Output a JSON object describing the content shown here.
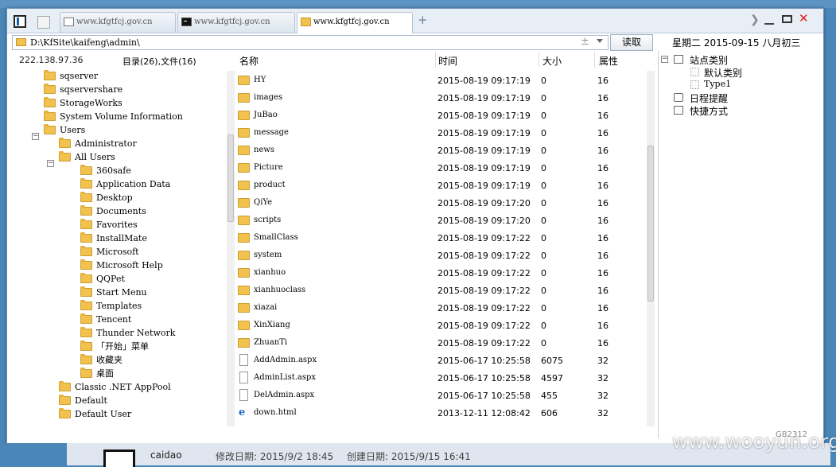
{
  "tabs": [
    {
      "label": "www.kfgtfcj.gov.cn",
      "icon": "page-icon"
    },
    {
      "label": "www.kfgtfcj.gov.cn",
      "icon": "terminal-icon"
    },
    {
      "label": "www.kfgtfcj.gov.cn",
      "icon": "folder-icon"
    }
  ],
  "new_tab": "+",
  "address": {
    "value": "D:\\KfSite\\kaifeng\\admin\\",
    "spin": "±",
    "read_button": "读取"
  },
  "date_label": "星期二 2015-09-15 八月初三",
  "info": {
    "ip": "222.138.97.36",
    "dir_count": "目录(26),文件(16)"
  },
  "columns": {
    "name": "名称",
    "time": "时间",
    "size": "大小",
    "attr": "属性"
  },
  "tree": [
    {
      "label": "sqserver"
    },
    {
      "label": "sqservershare"
    },
    {
      "label": "StorageWorks"
    },
    {
      "label": "System Volume Information"
    },
    {
      "label": "Users",
      "toggle": "⊟"
    },
    {
      "label": "Administrator"
    },
    {
      "label": "All Users",
      "toggle": "⊟"
    },
    {
      "label": "360safe"
    },
    {
      "label": "Application Data"
    },
    {
      "label": "Desktop"
    },
    {
      "label": "Documents"
    },
    {
      "label": "Favorites"
    },
    {
      "label": "InstallMate"
    },
    {
      "label": "Microsoft"
    },
    {
      "label": "Microsoft Help"
    },
    {
      "label": "QQPet"
    },
    {
      "label": "Start Menu"
    },
    {
      "label": "Templates"
    },
    {
      "label": "Tencent"
    },
    {
      "label": "Thunder Network"
    },
    {
      "label": "「开始」菜单"
    },
    {
      "label": "收藏夹"
    },
    {
      "label": "桌面"
    },
    {
      "label": "Classic .NET AppPool"
    },
    {
      "label": "Default"
    },
    {
      "label": "Default User"
    }
  ],
  "files": [
    {
      "name": "HY",
      "time": "2015-08-19 09:17:19",
      "size": "0",
      "attr": "16",
      "type": "folder"
    },
    {
      "name": "images",
      "time": "2015-08-19 09:17:19",
      "size": "0",
      "attr": "16",
      "type": "folder"
    },
    {
      "name": "JuBao",
      "time": "2015-08-19 09:17:19",
      "size": "0",
      "attr": "16",
      "type": "folder"
    },
    {
      "name": "message",
      "time": "2015-08-19 09:17:19",
      "size": "0",
      "attr": "16",
      "type": "folder"
    },
    {
      "name": "news",
      "time": "2015-08-19 09:17:19",
      "size": "0",
      "attr": "16",
      "type": "folder"
    },
    {
      "name": "Picture",
      "time": "2015-08-19 09:17:19",
      "size": "0",
      "attr": "16",
      "type": "folder"
    },
    {
      "name": "product",
      "time": "2015-08-19 09:17:19",
      "size": "0",
      "attr": "16",
      "type": "folder"
    },
    {
      "name": "QiYe",
      "time": "2015-08-19 09:17:20",
      "size": "0",
      "attr": "16",
      "type": "folder"
    },
    {
      "name": "scripts",
      "time": "2015-08-19 09:17:20",
      "size": "0",
      "attr": "16",
      "type": "folder"
    },
    {
      "name": "SmallClass",
      "time": "2015-08-19 09:17:22",
      "size": "0",
      "attr": "16",
      "type": "folder"
    },
    {
      "name": "system",
      "time": "2015-08-19 09:17:22",
      "size": "0",
      "attr": "16",
      "type": "folder"
    },
    {
      "name": "xianhuo",
      "time": "2015-08-19 09:17:22",
      "size": "0",
      "attr": "16",
      "type": "folder"
    },
    {
      "name": "xianhuoclass",
      "time": "2015-08-19 09:17:22",
      "size": "0",
      "attr": "16",
      "type": "folder"
    },
    {
      "name": "xiazai",
      "time": "2015-08-19 09:17:22",
      "size": "0",
      "attr": "16",
      "type": "folder"
    },
    {
      "name": "XinXiang",
      "time": "2015-08-19 09:17:22",
      "size": "0",
      "attr": "16",
      "type": "folder"
    },
    {
      "name": "ZhuanTi",
      "time": "2015-08-19 09:17:22",
      "size": "0",
      "attr": "16",
      "type": "folder"
    },
    {
      "name": "AddAdmin.aspx",
      "time": "2015-06-17 10:25:58",
      "size": "6075",
      "attr": "32",
      "type": "file"
    },
    {
      "name": "AdminList.aspx",
      "time": "2015-06-17 10:25:58",
      "size": "4597",
      "attr": "32",
      "type": "file"
    },
    {
      "name": "DelAdmin.aspx",
      "time": "2015-06-17 10:25:58",
      "size": "455",
      "attr": "32",
      "type": "file"
    },
    {
      "name": "down.html",
      "time": "2013-12-11 12:08:42",
      "size": "606",
      "attr": "32",
      "type": "html"
    }
  ],
  "right_panel": {
    "root": "站点类别",
    "children": [
      "默认类别",
      "Type1"
    ],
    "schedule": "日程提醒",
    "shortcut": "快捷方式"
  },
  "charset": "GB2312",
  "bottom": {
    "filename": "caidao",
    "modified": "修改日期: 2015/9/2 18:45",
    "created": "创建日期: 2015/9/15 16:41"
  },
  "watermark": "www.wooyun.org"
}
